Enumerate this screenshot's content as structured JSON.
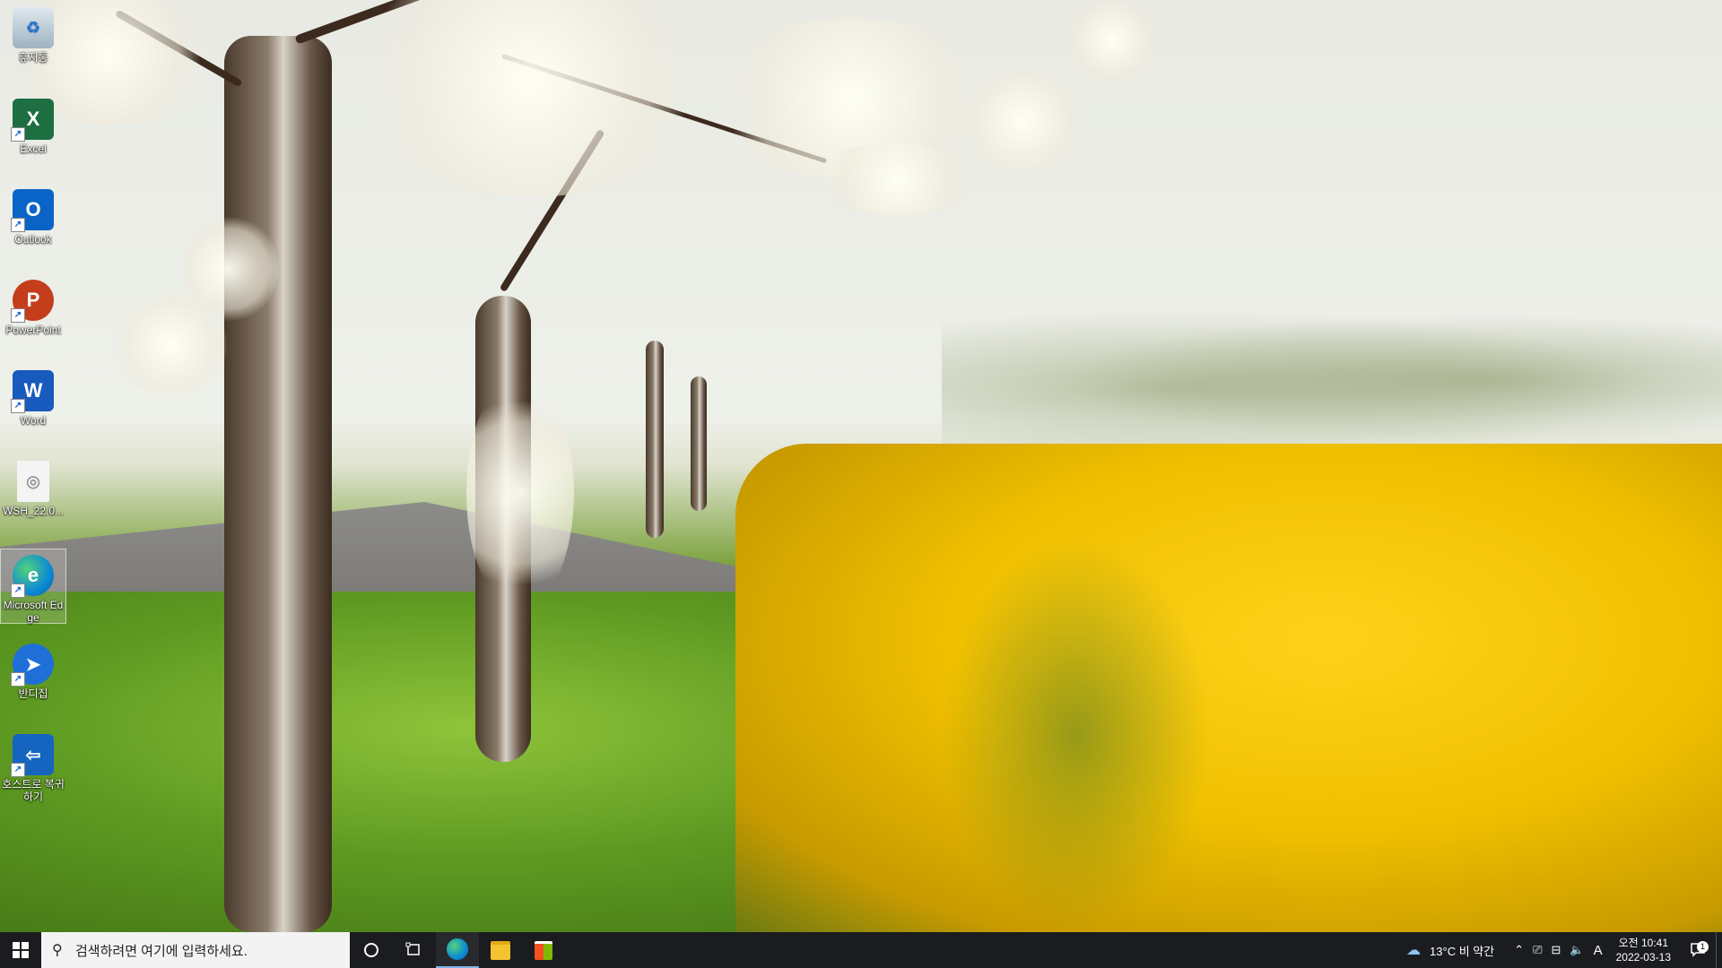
{
  "desktop": {
    "icons": [
      {
        "label": "휴지통",
        "icon": "recycle-bin-icon"
      },
      {
        "label": "Excel",
        "icon": "excel-icon"
      },
      {
        "label": "Outlook",
        "icon": "outlook-icon"
      },
      {
        "label": "PowerPoint",
        "icon": "powerpoint-icon"
      },
      {
        "label": "Word",
        "icon": "word-icon"
      },
      {
        "label": "WSH_22.0...",
        "icon": "file-icon"
      },
      {
        "label": "Microsoft Edge",
        "icon": "edge-icon"
      },
      {
        "label": "반디집",
        "icon": "bandizip-icon"
      },
      {
        "label": "호스트로 복귀하기",
        "icon": "return-to-host-icon"
      }
    ]
  },
  "taskbar": {
    "search_placeholder": "검색하려면 여기에 입력하세요.",
    "apps": [
      "edge-icon",
      "file-explorer-icon",
      "store-icon"
    ],
    "weather": "13°C 비 약간",
    "ime": "A",
    "time": "오전 10:41",
    "date": "2022-03-13",
    "notification_count": "1"
  },
  "colors": {
    "taskbar_bg": "#1a1c1f",
    "search_bg": "#f3f3f3",
    "excel": "#1d6f42",
    "outlook": "#0a64c8",
    "powerpoint": "#c43e1c",
    "word": "#185abd",
    "edge": "#0c8ad6"
  }
}
